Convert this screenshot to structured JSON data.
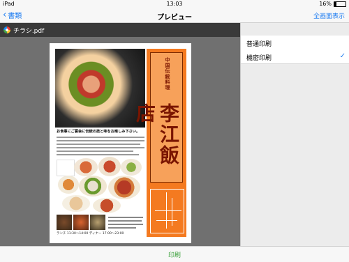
{
  "status": {
    "device": "iPad",
    "time": "13:03",
    "battery": "16%"
  },
  "nav": {
    "back_label": "書類",
    "title": "プレビュー",
    "right_label": "全画面表示"
  },
  "file": {
    "name": "チラシ.pdf"
  },
  "document": {
    "shop_type": "中国伝統料理",
    "shop_name": "李江飯店",
    "catch": "お食事にご宴会に伝統の技と味をお楽しみ下さい。",
    "hours": "ランチ 11:30～14:00 ディナー 17:00～23:00"
  },
  "print_options": [
    {
      "label": "普通印刷",
      "selected": false
    },
    {
      "label": "機密印刷",
      "selected": true
    }
  ],
  "toolbar": {
    "print_label": "印刷"
  },
  "colors": {
    "accent": "#1d7cf2",
    "print": "#3aa03a",
    "flyer_orange": "#f47a20"
  }
}
